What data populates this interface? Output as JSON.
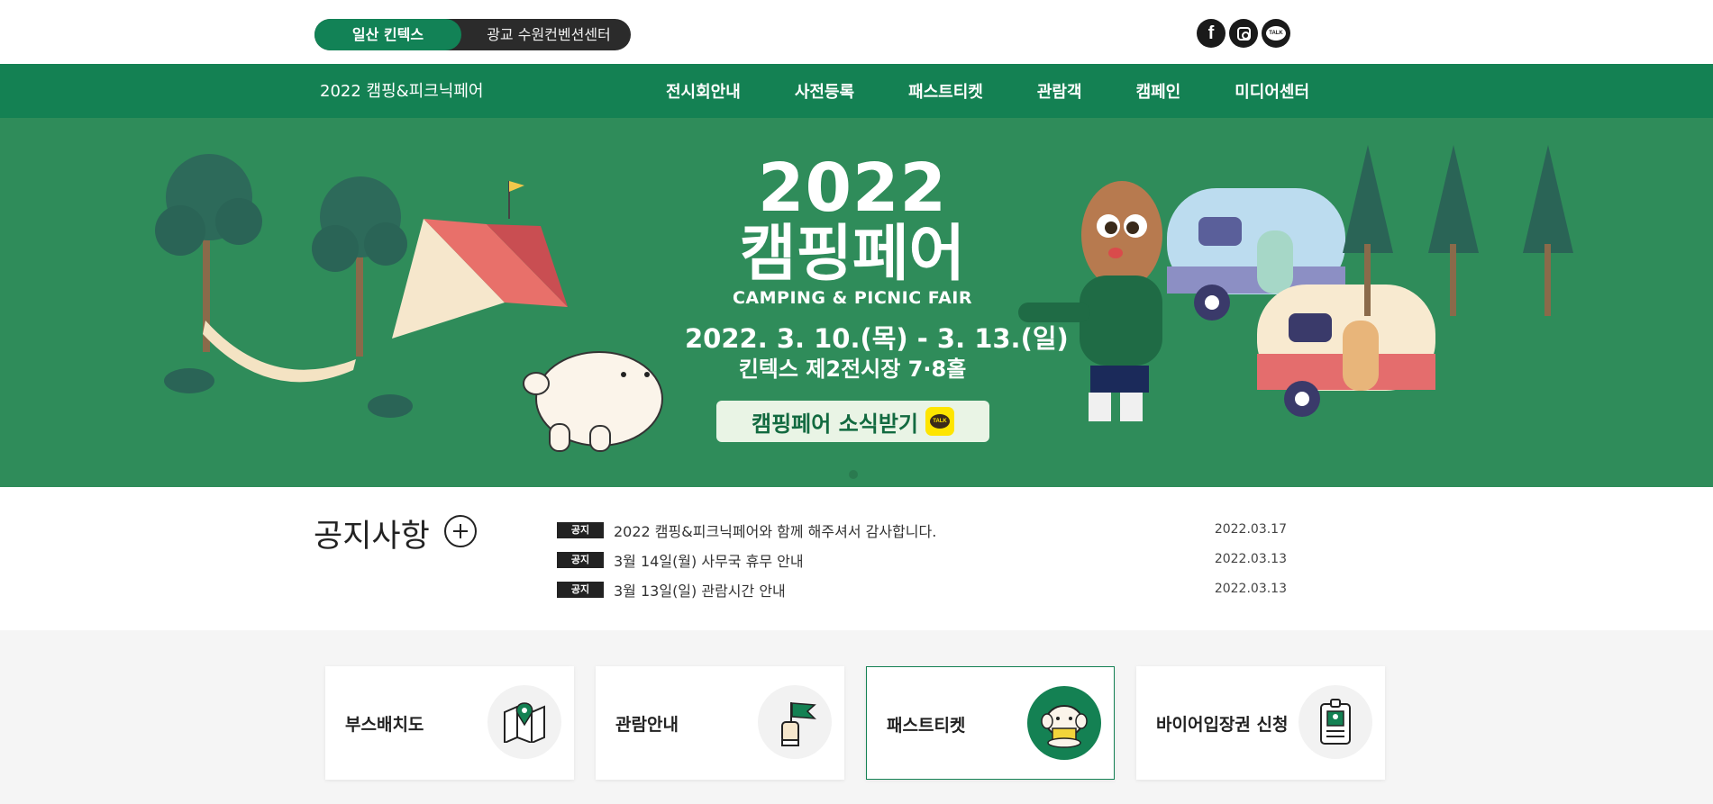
{
  "topbar": {
    "venues": [
      {
        "label": "일산 킨텍스",
        "active": true
      },
      {
        "label": "광교 수원컨벤션센터",
        "active": false
      }
    ],
    "social": [
      {
        "icon": "facebook-icon",
        "glyph": "f"
      },
      {
        "icon": "instagram-icon"
      },
      {
        "icon": "kakaotalk-icon",
        "glyph": "TALK"
      }
    ]
  },
  "nav": {
    "site_title": "2022 캠핑&피크닉페어",
    "menu": [
      "전시회안내",
      "사전등록",
      "패스트티켓",
      "관람객",
      "캠페인",
      "미디어센터"
    ]
  },
  "hero": {
    "year": "2022",
    "title": "캠핑페어",
    "subtitle": "CAMPING & PICNIC FAIR",
    "dates": "2022. 3. 10.(목) - 3. 13.(일)",
    "venue": "킨텍스 제2전시장 7·8홀",
    "cta_label": "캠핑페어 소식받기",
    "cta_badge": "TALK",
    "colors": {
      "background": "#2f8c5a",
      "cta_bg": "#e9f4e5",
      "cta_text": "#126a40"
    }
  },
  "notices": {
    "title": "공지사항",
    "items": [
      {
        "badge": "공지",
        "text": "2022 캠핑&피크닉페어와 함께 해주셔서 감사합니다.",
        "date": "2022.03.17"
      },
      {
        "badge": "공지",
        "text": "3월 14일(월) 사무국 휴무 안내",
        "date": "2022.03.13"
      },
      {
        "badge": "공지",
        "text": "3월 13일(일) 관람시간 안내",
        "date": "2022.03.13"
      }
    ]
  },
  "quick_links": [
    {
      "label": "부스배치도",
      "icon": "map-pin-icon",
      "selected": false
    },
    {
      "label": "관람안내",
      "icon": "hand-flag-icon",
      "selected": false
    },
    {
      "label": "패스트티켓",
      "icon": "mascot-ticket-icon",
      "selected": true
    },
    {
      "label": "바이어입장권 신청",
      "icon": "id-badge-icon",
      "selected": false
    }
  ],
  "colors": {
    "brand_green": "#148153",
    "dark": "#2b2b2b"
  }
}
